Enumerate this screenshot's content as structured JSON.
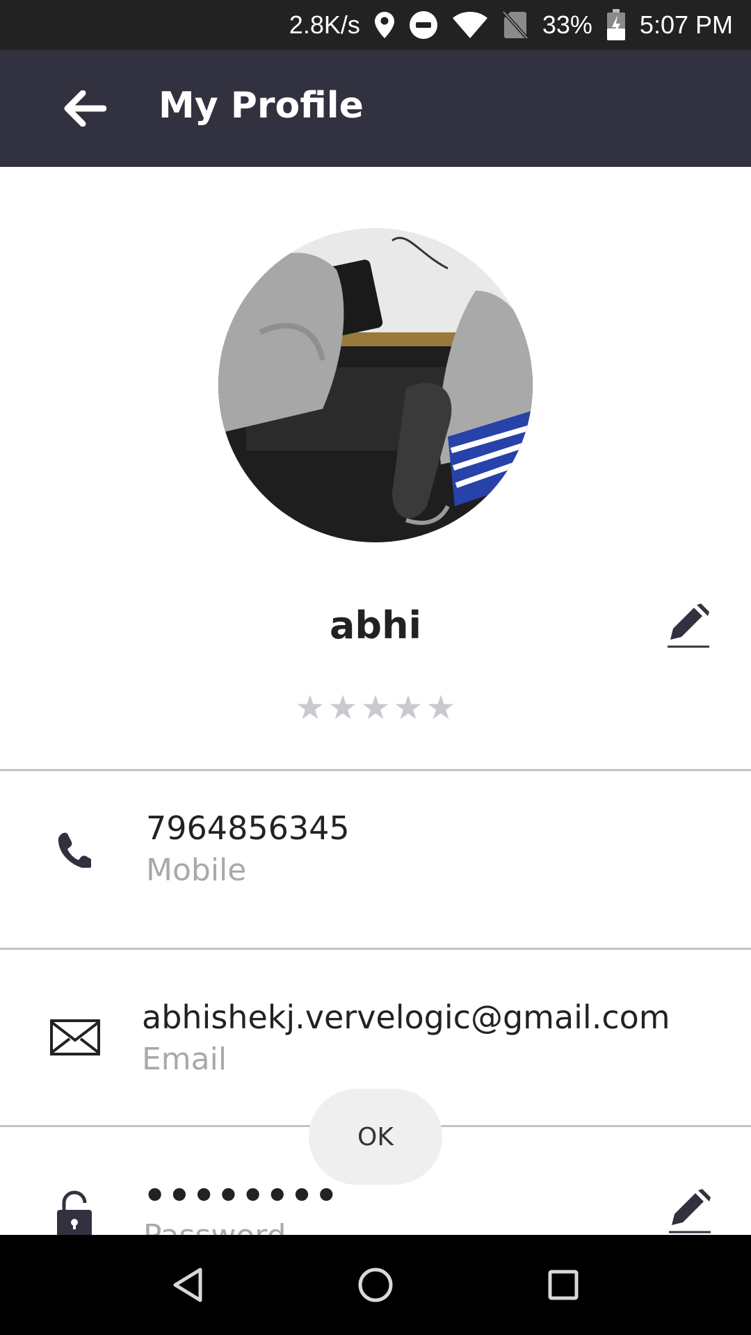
{
  "status_bar": {
    "network_speed": "2.8K/s",
    "battery_percent": "33%",
    "time": "5:07 PM",
    "icons": [
      "location-icon",
      "dnd-icon",
      "wifi-icon",
      "no-sim-icon",
      "battery-charging-icon"
    ]
  },
  "app_bar": {
    "title": "My Profile",
    "back_icon": "arrow-left-icon"
  },
  "profile": {
    "name": "abhi",
    "rating": 0,
    "rating_max": 5
  },
  "fields": {
    "mobile": {
      "value": "7964856345",
      "label": "Mobile",
      "icon": "phone-icon"
    },
    "email": {
      "value": "abhishekj.vervelogic@gmail.com",
      "label": "Email",
      "icon": "mail-icon"
    },
    "password": {
      "value": "••••••••",
      "label": "Password",
      "icon": "lock-icon"
    }
  },
  "toast": {
    "ok_label": "OK"
  },
  "nav": {
    "icons": [
      "back-triangle-icon",
      "home-circle-icon",
      "recents-square-icon"
    ]
  },
  "colors": {
    "status_bar": "#222222",
    "app_bar": "#323140",
    "icon_dark": "#323140",
    "star_empty": "#c9c9ce",
    "label_gray": "#a9a9ad"
  }
}
